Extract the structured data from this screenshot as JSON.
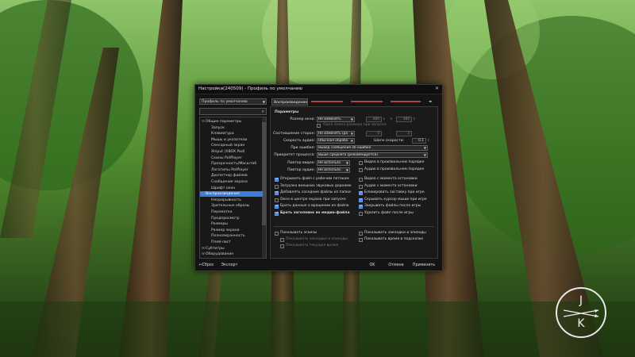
{
  "window": {
    "title": "Настройки(240509) - Профиль по умолчанию",
    "close_icon": "close-icon"
  },
  "profile_select": {
    "value": "Профиль по умолчанию"
  },
  "tabs": [
    {
      "label": "Воспроизведение"
    },
    {
      "label": ""
    },
    {
      "label": ""
    }
  ],
  "tree": [
    {
      "label": "Общие параметры",
      "level": 0,
      "expander": "⊟"
    },
    {
      "label": "Запуск",
      "level": 1
    },
    {
      "label": "Клавиатура",
      "level": 1
    },
    {
      "label": "Мышь и указатели",
      "level": 1
    },
    {
      "label": "Сенсорный экран",
      "level": 1
    },
    {
      "label": "XInput (XBOX Pad)",
      "level": 1
    },
    {
      "label": "Скины PotPlayer",
      "level": 1
    },
    {
      "label": "Прозрачность/Масштаб",
      "level": 1
    },
    {
      "label": "Логотипы PotPlayer",
      "level": 1
    },
    {
      "label": "Диспетчер файлов",
      "level": 1
    },
    {
      "label": "Сообщения экрана",
      "level": 1
    },
    {
      "label": "Шрифт окон",
      "level": 1
    },
    {
      "label": "Воспроизведение",
      "level": 0,
      "expander": "⊟",
      "selected": true
    },
    {
      "label": "Непрерывность",
      "level": 1
    },
    {
      "label": "Зрительные образы",
      "level": 1
    },
    {
      "label": "Перемотка",
      "level": 1
    },
    {
      "label": "Предпросмотр",
      "level": 1
    },
    {
      "label": "Размеры",
      "level": 1
    },
    {
      "label": "Размер экрана",
      "level": 1
    },
    {
      "label": "Полноэкранность",
      "level": 1
    },
    {
      "label": "Плей-лист",
      "level": 1
    },
    {
      "label": "Субтитры",
      "level": 0,
      "expander": "⊞"
    },
    {
      "label": "Оборудование",
      "level": 0,
      "expander": "⊞"
    }
  ],
  "params": {
    "header": "Параметры",
    "window_size": {
      "label": "Размер окна:",
      "value": "Не изменять",
      "width": "480",
      "height": "384"
    },
    "once_size_cb": "Одна смена размера при запуске",
    "aspect": {
      "label": "Соотношение сторон:",
      "value": "Не изменять (ра",
      "a": "4",
      "b": "3"
    },
    "audio_speed": {
      "label": "Скорость аудио:",
      "value": "Обычная обрабо",
      "step_label": "Шаги скорости:",
      "step": "0.1"
    },
    "on_error": {
      "label": "При ошибке:",
      "value": "Вывод сообщения об ошибке"
    },
    "priority": {
      "label": "Приоритет процесса:",
      "value": "Выше среднего (рекомендуется)"
    },
    "repeat_video": {
      "label": "Повтор видео:",
      "value": "Не использо",
      "random_label": "Видео в произвольном порядке"
    },
    "repeat_audio": {
      "label": "Повтор аудио:",
      "value": "Не использо",
      "random_label": "Аудио в произвольном порядке"
    }
  },
  "checks_left": [
    {
      "label": "Открывать файл с рабочим потоком",
      "on": true
    },
    {
      "label": "Загрузка внешних звуковых дорожек",
      "on": false
    },
    {
      "label": "Добавлять соседние файлы из папки",
      "on": true
    },
    {
      "label": "Окно в центре экрана при запуске",
      "on": false
    },
    {
      "label": "Брать данные о вращении из файла",
      "on": true
    },
    {
      "label": "Брать заголовок из медиа-файла",
      "on": true,
      "bold": true
    }
  ],
  "checks_right": [
    {
      "label": "Видео с момента остановки",
      "on": false
    },
    {
      "label": "Аудио с момента остановки",
      "on": false
    },
    {
      "label": "Блокировать заставку при игре",
      "on": true
    },
    {
      "label": "Скрывать курсор мыши при игре",
      "on": true
    },
    {
      "label": "Закрывать файлы после игры",
      "on": true
    },
    {
      "label": "Удалить файл после игры",
      "on": false
    }
  ],
  "extra": {
    "show_sketches": "Показывать эскизы",
    "show_bookmarks_chapters": "Показывать закладки и эпизоды",
    "show_current_time": "Показывать текущее время",
    "show_bookmarks_episodes": "Показывать закладки и эпизоды",
    "show_time_hint": "Показывать время в подсказке"
  },
  "buttons": {
    "reset": "Сброс",
    "export": "Экспорт",
    "ok": "OK",
    "cancel": "Отмена",
    "apply": "Применить"
  },
  "watermark": {
    "top": "J",
    "bottom": "K"
  }
}
